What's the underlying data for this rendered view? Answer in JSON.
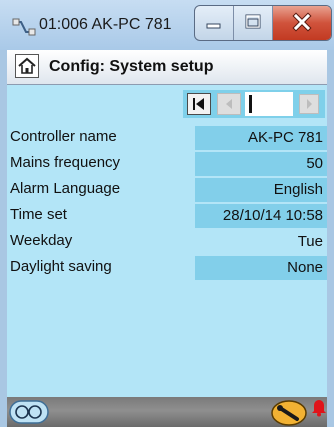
{
  "window": {
    "title": "01:006 AK-PC 781"
  },
  "header": {
    "title": "Config: System setup"
  },
  "settings": [
    {
      "label": "Controller name",
      "value": "AK-PC 781",
      "editable": true
    },
    {
      "label": "Mains frequency",
      "value": "50",
      "editable": true
    },
    {
      "label": "Alarm Language",
      "value": "English",
      "editable": true
    },
    {
      "label": "Time set",
      "value": "28/10/14 10:58",
      "editable": true
    },
    {
      "label": "Weekday",
      "value": "Tue",
      "editable": false
    },
    {
      "label": "Daylight saving",
      "value": "None",
      "editable": true
    }
  ],
  "icons": {
    "app": "network-cable-icon",
    "home": "home-icon",
    "nav_first": "first-page-icon",
    "nav_prev": "previous-page-icon",
    "nav_next": "next-page-icon",
    "glasses": "glasses-icon",
    "wrench": "wrench-icon",
    "alarm": "alarm-bell-icon"
  },
  "colors": {
    "content_bg": "#b3e5f7",
    "editable_field": "#82cfea",
    "footer_bg": "#7a7a7a",
    "wrench_button": "#f2b233",
    "alarm": "#e0141a",
    "close_button": "#c9402a"
  }
}
